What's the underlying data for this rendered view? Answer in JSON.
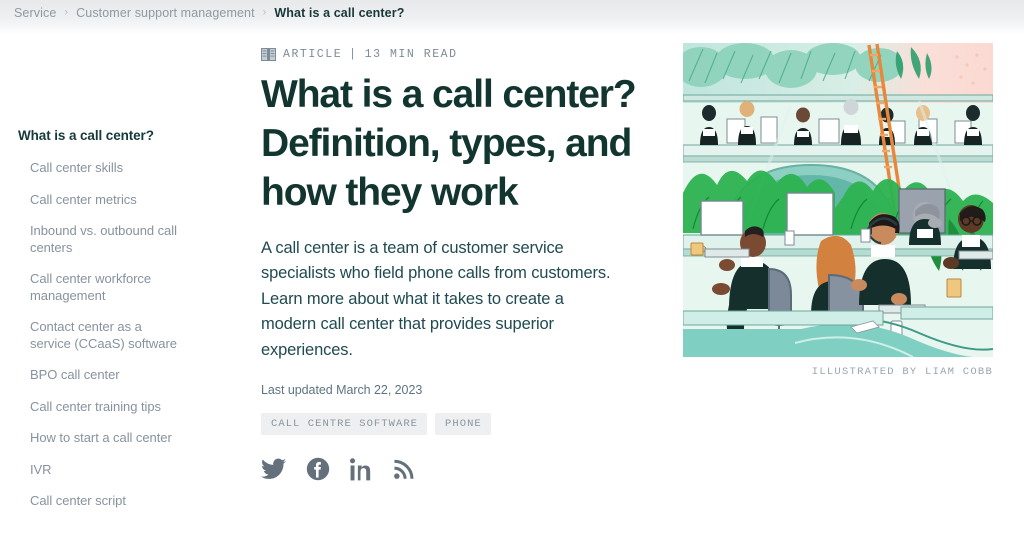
{
  "breadcrumb": {
    "separator": "›",
    "items": [
      {
        "label": "Service",
        "current": false
      },
      {
        "label": "Customer support management",
        "current": false
      },
      {
        "label": "What is a call center?",
        "current": true
      }
    ]
  },
  "sidebar": {
    "title": "What is a call center?",
    "items": [
      {
        "label": "Call center skills"
      },
      {
        "label": "Call center metrics"
      },
      {
        "label": "Inbound vs. outbound call centers"
      },
      {
        "label": "Call center workforce management"
      },
      {
        "label": "Contact center as a service (CCaaS) software"
      },
      {
        "label": "BPO call center"
      },
      {
        "label": "Call center training tips"
      },
      {
        "label": "How to start a call center"
      },
      {
        "label": "IVR"
      },
      {
        "label": "Call center script"
      }
    ]
  },
  "article": {
    "meta": {
      "icon": "open-book-icon",
      "type": "ARTICLE",
      "divider": "|",
      "read_time": "13 MIN READ"
    },
    "headline": "What is a call center? Definition, types, and how they work",
    "lede": "A call center is a team of customer service specialists who field phone calls from customers. Learn more about what it takes to create a modern call center that provides superior experiences.",
    "last_updated": "Last updated March 22, 2023",
    "tags": [
      "CALL CENTRE SOFTWARE",
      "PHONE"
    ],
    "socials": [
      {
        "name": "twitter-icon"
      },
      {
        "name": "facebook-icon"
      },
      {
        "name": "linkedin-icon"
      },
      {
        "name": "rss-icon"
      }
    ]
  },
  "illustration": {
    "caption": "ILLUSTRATED BY LIAM COBB",
    "alt": "Call center agents wearing headsets working at teal desks with monitors, plants and a mezzanine above"
  },
  "colors": {
    "headline": "#12352f",
    "body": "#1f4a51",
    "muted": "#8792a0",
    "tag_bg": "#edeff0",
    "social": "#64717d"
  }
}
